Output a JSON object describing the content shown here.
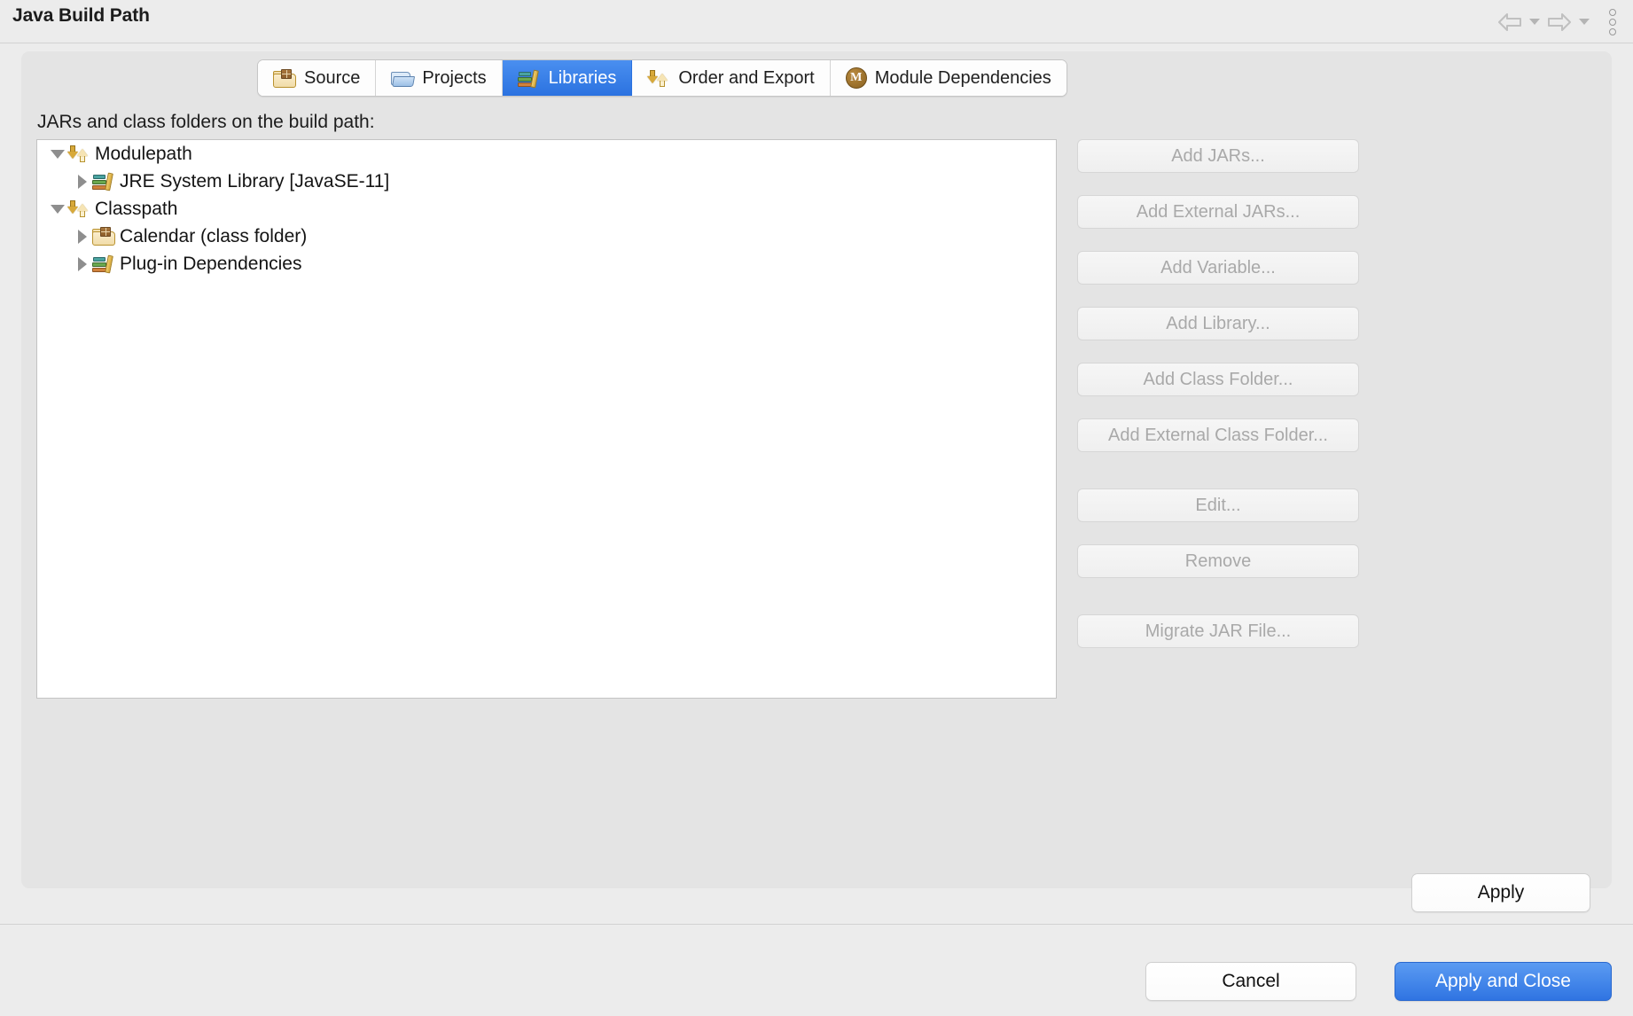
{
  "window": {
    "title": "Java Build Path"
  },
  "titlebar_nav": {
    "back_icon": "back-arrow-icon",
    "back_caret_icon": "chevron-down-icon",
    "forward_icon": "forward-arrow-icon",
    "forward_caret_icon": "chevron-down-icon",
    "menu_icon": "vertical-ellipsis-icon"
  },
  "tabs": [
    {
      "label": "Source",
      "icon": "source-folder-icon",
      "active": false
    },
    {
      "label": "Projects",
      "icon": "projects-folder-icon",
      "active": false
    },
    {
      "label": "Libraries",
      "icon": "libraries-books-icon",
      "active": true
    },
    {
      "label": "Order and Export",
      "icon": "order-export-arrows-icon",
      "active": false
    },
    {
      "label": "Module Dependencies",
      "icon": "module-badge-icon",
      "active": false
    }
  ],
  "main": {
    "section_label": "JARs and class folders on the build path:"
  },
  "tree": [
    {
      "label": "Modulepath",
      "icon": "order-export-arrows-icon",
      "level": 1,
      "expanded": true,
      "twisty": "expanded"
    },
    {
      "label": "JRE System Library [JavaSE-11]",
      "icon": "libraries-books-icon",
      "level": 2,
      "expanded": false,
      "twisty": "collapsed"
    },
    {
      "label": "Classpath",
      "icon": "order-export-arrows-icon",
      "level": 1,
      "expanded": true,
      "twisty": "expanded"
    },
    {
      "label": "Calendar (class folder)",
      "icon": "class-folder-icon",
      "level": 2,
      "expanded": false,
      "twisty": "collapsed"
    },
    {
      "label": "Plug-in Dependencies",
      "icon": "libraries-books-icon",
      "level": 2,
      "expanded": false,
      "twisty": "collapsed"
    }
  ],
  "side_buttons": [
    {
      "label": "Add JARs...",
      "enabled": false
    },
    {
      "label": "Add External JARs...",
      "enabled": false
    },
    {
      "label": "Add Variable...",
      "enabled": false
    },
    {
      "label": "Add Library...",
      "enabled": false
    },
    {
      "label": "Add Class Folder...",
      "enabled": false
    },
    {
      "label": "Add External Class Folder...",
      "enabled": false
    },
    {
      "label": "Edit...",
      "enabled": false
    },
    {
      "label": "Remove",
      "enabled": false
    },
    {
      "label": "Migrate JAR File...",
      "enabled": false
    }
  ],
  "actions": {
    "apply": "Apply",
    "cancel": "Cancel",
    "apply_and_close": "Apply and Close"
  },
  "colors": {
    "accent_blue": "#2f74e2",
    "tab_active_blue": "#3b7fe8",
    "dialog_bg": "#ececec",
    "card_bg": "#e4e4e4",
    "tree_bg": "#ffffff",
    "disabled_text": "#a9a9a9"
  }
}
